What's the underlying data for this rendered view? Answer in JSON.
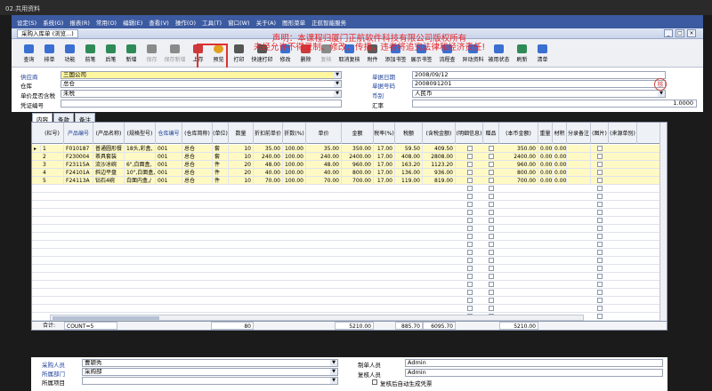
{
  "window": {
    "title": "02.共用资料"
  },
  "menu": [
    "设定(S)",
    "系统(G)",
    "报表(R)",
    "常用(O)",
    "编辑(E)",
    "查看(V)",
    "操作(O)",
    "工具(T)",
    "窗口(W)",
    "关于(A)",
    "图形菜单",
    "正航智能服务"
  ],
  "doc_tab": "采购入库单 (浏览...)",
  "notice": {
    "line1": "声明：本课程归厦门正航软件科技有限公司版权所有",
    "line2": "未经允许不得录制、修改、传播，违者将追究法律和经济责任!"
  },
  "toolbar": [
    {
      "label": "查询",
      "icon": "search-icon"
    },
    {
      "label": "排单",
      "icon": "sort-icon"
    },
    {
      "label": "功能",
      "icon": "function-icon"
    },
    {
      "label": "前笔",
      "icon": "prev-icon"
    },
    {
      "label": "后笔",
      "icon": "next-icon"
    },
    {
      "label": "新增",
      "icon": "new-icon"
    },
    {
      "label": "保存",
      "icon": "save-icon"
    },
    {
      "label": "保存新增",
      "icon": "save-new-icon"
    },
    {
      "label": "上存",
      "icon": "upload-icon"
    },
    {
      "label": "预览",
      "icon": "preview-icon"
    },
    {
      "label": "打印",
      "icon": "print-icon"
    },
    {
      "label": "快速打印",
      "icon": "quick-print-icon"
    },
    {
      "label": "修改",
      "icon": "edit-icon"
    },
    {
      "label": "删除",
      "icon": "delete-icon"
    },
    {
      "label": "复核",
      "icon": "check-icon"
    },
    {
      "label": "取消复核",
      "icon": "uncheck-icon"
    },
    {
      "label": "附件",
      "icon": "attach-icon"
    },
    {
      "label": "添加书签",
      "icon": "bookmark-icon"
    },
    {
      "label": "展示书签",
      "icon": "bookmark-list-icon"
    },
    {
      "label": "流程查",
      "icon": "flow-icon"
    },
    {
      "label": "异动资料",
      "icon": "change-icon"
    },
    {
      "label": "被用状态",
      "icon": "status-icon"
    },
    {
      "label": "刷新",
      "icon": "refresh-icon"
    },
    {
      "label": "清单",
      "icon": "list-icon"
    }
  ],
  "form": {
    "supplier_label": "供应商",
    "supplier_value": "三国公司",
    "warehouse_label": "仓库",
    "warehouse_value": "总仓",
    "taxprice_label": "单价是否含税",
    "taxprice_value": "未税",
    "voucher_label": "凭证编号",
    "voucher_value": "",
    "date_label": "单据日期",
    "date_value": "2008/09/12",
    "docno_label": "单据号码",
    "docno_value": "2008091201",
    "currency_label": "币别",
    "currency_value": "人民币",
    "rate_label": "汇率",
    "rate_value": "1.0000",
    "stamp": "核"
  },
  "tabs": [
    "内容",
    "条款",
    "备注"
  ],
  "columns": [
    "(栏号)",
    "产品编号",
    "(产品名称)",
    "(规格型号)",
    "仓库编号",
    "(仓库简称)",
    "(单位)",
    "数量",
    "折扣前单价",
    "折数(%)",
    "单价",
    "金额",
    "税率(%)",
    "税额",
    "(含税金额)",
    "(明细信息)",
    "赠品",
    "(本币金额)",
    "重量",
    "材积",
    "分录备注",
    "(图片)",
    "(来源单别)"
  ],
  "rows": [
    [
      "",
      "F010187",
      "普通圆形餐",
      "18头,彩盒,",
      "001",
      "总仓",
      "套",
      "10",
      "35.00",
      "100.00",
      "35.00",
      "350.00",
      "17.00",
      "59.50",
      "409.50",
      "",
      "",
      "350.00",
      "0.00",
      "0.00",
      "",
      "",
      ""
    ],
    [
      "",
      "F230004",
      "茶具套装",
      "",
      "001",
      "总仓",
      "套",
      "10",
      "240.00",
      "100.00",
      "240.00",
      "2400.00",
      "17.00",
      "408.00",
      "2808.00",
      "",
      "",
      "2400.00",
      "0.00",
      "0.00",
      "",
      "",
      ""
    ],
    [
      "",
      "F23115A",
      "流沙冰碗",
      "6\",白面盒,",
      "001",
      "总仓",
      "件",
      "20",
      "48.00",
      "100.00",
      "48.00",
      "960.00",
      "17.00",
      "163.20",
      "1123.20",
      "",
      "",
      "960.00",
      "0.00",
      "0.00",
      "",
      "",
      ""
    ],
    [
      "",
      "F24101A",
      "斜边平盘",
      "10\",白面盒,",
      "001",
      "总仓",
      "件",
      "20",
      "40.00",
      "100.00",
      "40.00",
      "800.00",
      "17.00",
      "136.00",
      "936.00",
      "",
      "",
      "800.00",
      "0.00",
      "0.00",
      "",
      "",
      ""
    ],
    [
      "",
      "F24113A",
      "钻石4碗",
      "白面内盒,/",
      "001",
      "总仓",
      "件",
      "10",
      "70.00",
      "100.00",
      "70.00",
      "700.00",
      "17.00",
      "119.00",
      "819.00",
      "",
      "",
      "700.00",
      "0.00",
      "0.00",
      "",
      "",
      ""
    ]
  ],
  "totals": {
    "label": "合计:",
    "count": "COUNT=5",
    "qty": "80",
    "amount": "5210.00",
    "tax": "885.70",
    "tax_amount": "6095.70",
    "local": "5210.00"
  },
  "footer": {
    "buyer_label": "采购人员",
    "buyer_value": "曹颖秀",
    "dept_label": "所属部门",
    "dept_value": "采购部",
    "project_label": "所属项目",
    "project_value": "",
    "maker_label": "制单人员",
    "maker_value": "Admin",
    "reviewer_label": "复核人员",
    "reviewer_value": "Admin",
    "auto_label": "复核后自动生成凭票"
  }
}
